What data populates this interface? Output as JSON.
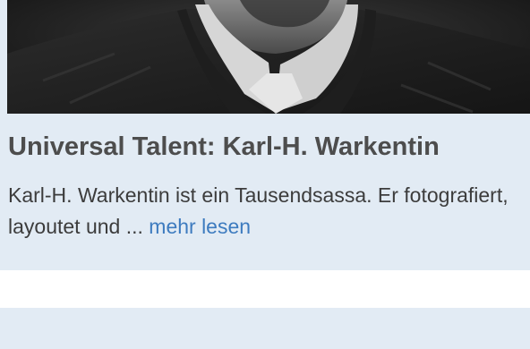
{
  "article": {
    "photo_alt": "Karl-H. Warkentin portrait",
    "title": "Universal Talent: Karl-H. Warkentin",
    "excerpt": "Karl-H. Warkentin ist ein Tausendsassa. Er fotografiert, layoutet und ...",
    "more_link": "mehr lesen"
  }
}
